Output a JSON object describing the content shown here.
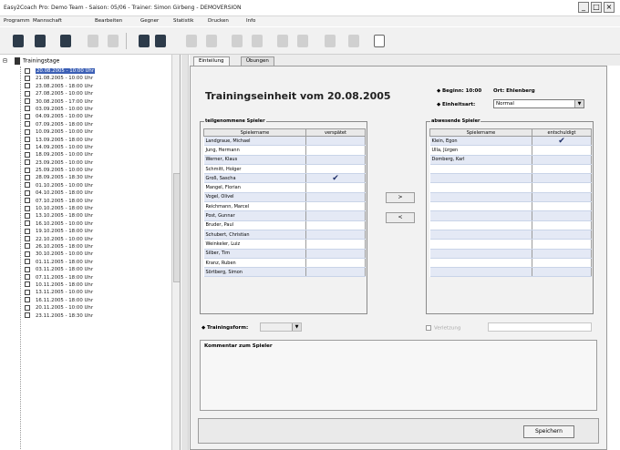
{
  "window": {
    "title": "Easy2Coach Pro: Demo Team - Saison: 05/06 - Trainer: Simon Girbeng - DEMOVERSION",
    "buttons": [
      "_",
      "□",
      "×"
    ]
  },
  "menu": [
    "Programm",
    "Mannschaft",
    "Bearbeiten",
    "Gegner",
    "Statistik",
    "Drucken",
    "Info"
  ],
  "tree": {
    "root": "Trainingstage",
    "items": [
      "20.08.2005 - 10:00 Uhr",
      "21.08.2005 - 10:00 Uhr",
      "23.08.2005 - 18:00 Uhr",
      "27.08.2005 - 10:00 Uhr",
      "30.08.2005 - 17:00 Uhr",
      "03.09.2005 - 10:00 Uhr",
      "04.09.2005 - 10:00 Uhr",
      "07.09.2005 - 18:00 Uhr",
      "10.09.2005 - 10:00 Uhr",
      "13.09.2005 - 18:00 Uhr",
      "14.09.2005 - 10:00 Uhr",
      "18.09.2005 - 10:00 Uhr",
      "23.09.2005 - 10:00 Uhr",
      "25.09.2005 - 10:00 Uhr",
      "28.09.2005 - 18:30 Uhr",
      "01.10.2005 - 10:00 Uhr",
      "04.10.2005 - 18:00 Uhr",
      "07.10.2005 - 18:00 Uhr",
      "10.10.2005 - 18:00 Uhr",
      "13.10.2005 - 18:00 Uhr",
      "16.10.2005 - 10:00 Uhr",
      "19.10.2005 - 18:00 Uhr",
      "22.10.2005 - 10:00 Uhr",
      "26.10.2005 - 18:00 Uhr",
      "30.10.2005 - 10:00 Uhr",
      "01.11.2005 - 18:00 Uhr",
      "03.11.2005 - 18:00 Uhr",
      "07.11.2005 - 18:00 Uhr",
      "10.11.2005 - 18:00 Uhr",
      "13.11.2005 - 10:00 Uhr",
      "16.11.2005 - 18:00 Uhr",
      "20.11.2005 - 10:00 Uhr",
      "23.11.2005 - 18:30 Uhr"
    ]
  },
  "tabs": [
    "Einteilung",
    "Übungen"
  ],
  "main": {
    "heading": "Trainingseinheit vom 20.08.2005",
    "beginn_label": "Beginn: 10:00",
    "ort_label": "Ort: Ehlenberg",
    "einheit_label": "Einheitsart:",
    "einheit_value": "Normal",
    "left_group": {
      "title": "teilgenommene Spieler",
      "col_name": "Spielername",
      "col_flag": "verspätet",
      "rows": [
        {
          "name": "Landgraue, Michael",
          "flag": ""
        },
        {
          "name": "Jung, Hermann",
          "flag": ""
        },
        {
          "name": "Werner, Klaus",
          "flag": ""
        },
        {
          "name": "Schmitt, Holger",
          "flag": ""
        },
        {
          "name": "Groß, Sascha",
          "flag": "✔"
        },
        {
          "name": "Mangel, Florian",
          "flag": ""
        },
        {
          "name": "Vogel, Olivel",
          "flag": ""
        },
        {
          "name": "Reichmann, Marcel",
          "flag": ""
        },
        {
          "name": "Post, Gunnar",
          "flag": ""
        },
        {
          "name": "Bruder, Paul",
          "flag": ""
        },
        {
          "name": "Schubert, Christian",
          "flag": ""
        },
        {
          "name": "Weinkeler, Luiz",
          "flag": ""
        },
        {
          "name": "Silber, Tim",
          "flag": ""
        },
        {
          "name": "Kranz, Ruben",
          "flag": ""
        },
        {
          "name": "Sörtberg, Simon",
          "flag": ""
        }
      ]
    },
    "right_group": {
      "title": "abwesende Spieler",
      "col_name": "Spielername",
      "col_flag": "entschuldigt",
      "rows": [
        {
          "name": "Klein, Egon",
          "flag": "✔"
        },
        {
          "name": "Ulla, Jürgen",
          "flag": ""
        },
        {
          "name": "Domberg, Karl",
          "flag": ""
        }
      ]
    },
    "move_right": ">",
    "move_left": "<",
    "trainingsform_label": "Trainingsform:",
    "verletzung_label": "Verletzung",
    "comment_label": "Kommentar zum Spieler",
    "save_label": "Speichern"
  }
}
